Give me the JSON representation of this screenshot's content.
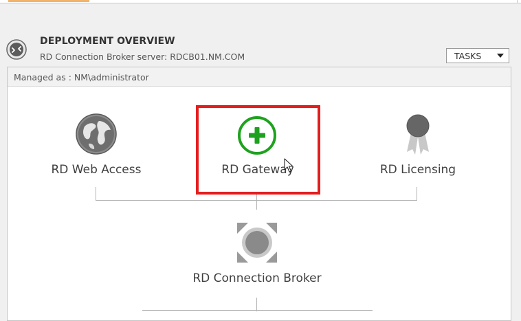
{
  "header": {
    "title": "DEPLOYMENT OVERVIEW",
    "subtitle": "RD Connection Broker server: RDCB01.NM.COM",
    "tasks_label": "TASKS",
    "icon": "deployment-overview-icon"
  },
  "panel": {
    "managed_as": "Managed as : NM\\administrator"
  },
  "roles": {
    "web_access": {
      "label": "RD Web Access",
      "icon": "globe-icon"
    },
    "gateway": {
      "label": "RD Gateway",
      "icon": "add-circle-icon",
      "highlighted": true
    },
    "licensing": {
      "label": "RD Licensing",
      "icon": "ribbon-award-icon"
    },
    "connection_broker": {
      "label": "RD Connection Broker",
      "icon": "connection-broker-icon"
    }
  },
  "colors": {
    "highlight": "#e41d1d",
    "gateway_green": "#1ea21e",
    "tab_accent": "#f3b36a"
  }
}
